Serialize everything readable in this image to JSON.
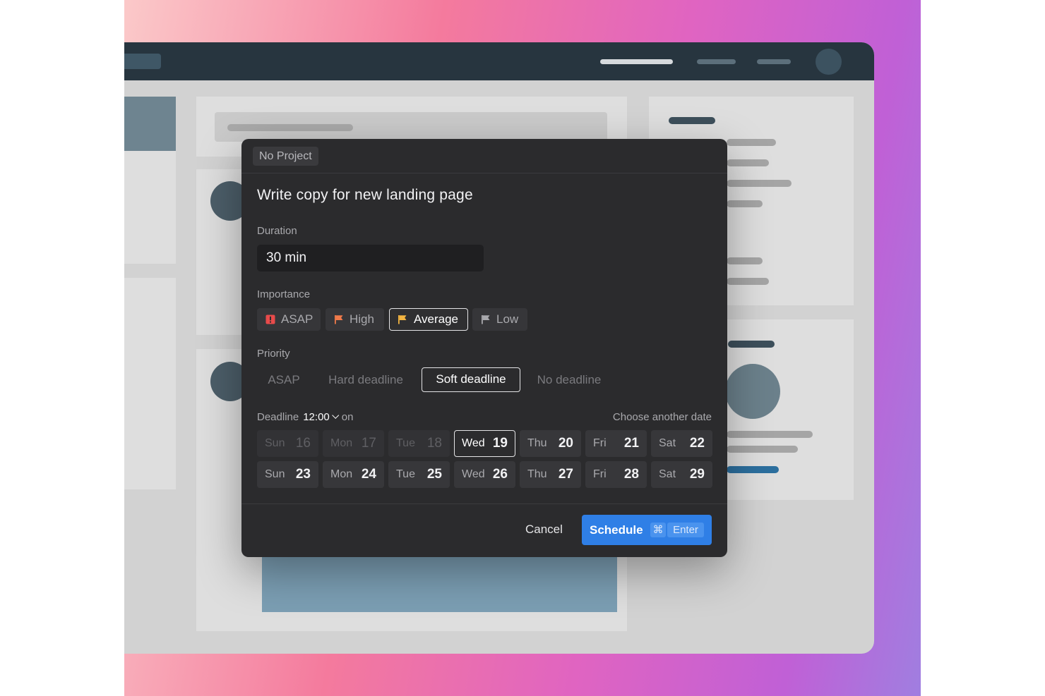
{
  "colors": {
    "accent": "#2f7fe6",
    "asap": "#e84b4b",
    "high": "#f07a4a",
    "average": "#f2b441",
    "low": "#a9a9ad",
    "modal_bg": "#2b2b2d"
  },
  "modal": {
    "project_badge": "No Project",
    "task_title": "Write copy for new landing page",
    "duration": {
      "label": "Duration",
      "value": "30 min"
    },
    "importance": {
      "label": "Importance",
      "options": [
        {
          "label": "ASAP",
          "icon": "alert-square-icon",
          "selected": false
        },
        {
          "label": "High",
          "icon": "flag-icon",
          "selected": false
        },
        {
          "label": "Average",
          "icon": "flag-icon",
          "selected": true
        },
        {
          "label": "Low",
          "icon": "flag-icon",
          "selected": false
        }
      ]
    },
    "priority": {
      "label": "Priority",
      "options": [
        {
          "label": "ASAP",
          "selected": false
        },
        {
          "label": "Hard deadline",
          "selected": false
        },
        {
          "label": "Soft deadline",
          "selected": true
        },
        {
          "label": "No deadline",
          "selected": false
        }
      ]
    },
    "deadline": {
      "label": "Deadline",
      "time": "12:00",
      "on": "on",
      "choose_another": "Choose another date",
      "days": [
        {
          "name": "Sun",
          "date": "16",
          "state": "past"
        },
        {
          "name": "Mon",
          "date": "17",
          "state": "past"
        },
        {
          "name": "Tue",
          "date": "18",
          "state": "past"
        },
        {
          "name": "Wed",
          "date": "19",
          "state": "selected"
        },
        {
          "name": "Thu",
          "date": "20",
          "state": "normal"
        },
        {
          "name": "Fri",
          "date": "21",
          "state": "normal"
        },
        {
          "name": "Sat",
          "date": "22",
          "state": "normal"
        },
        {
          "name": "Sun",
          "date": "23",
          "state": "normal"
        },
        {
          "name": "Mon",
          "date": "24",
          "state": "normal"
        },
        {
          "name": "Tue",
          "date": "25",
          "state": "normal"
        },
        {
          "name": "Wed",
          "date": "26",
          "state": "normal"
        },
        {
          "name": "Thu",
          "date": "27",
          "state": "normal"
        },
        {
          "name": "Fri",
          "date": "28",
          "state": "normal"
        },
        {
          "name": "Sat",
          "date": "29",
          "state": "normal"
        }
      ]
    },
    "footer": {
      "cancel": "Cancel",
      "schedule": "Schedule",
      "shortcut_cmd": "⌘",
      "shortcut_key": "Enter"
    }
  }
}
